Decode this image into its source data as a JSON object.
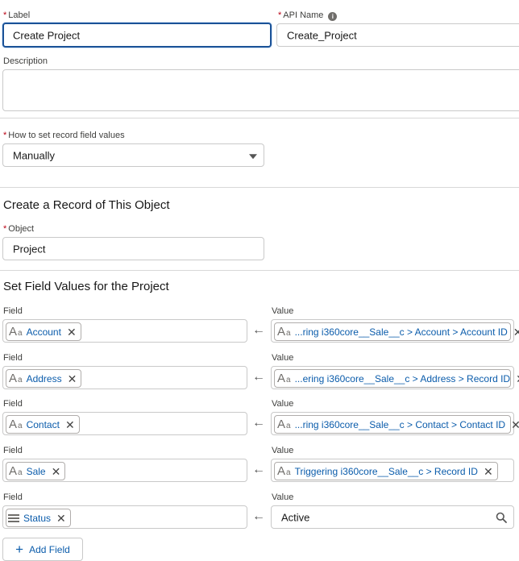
{
  "label": {
    "required": "*",
    "title": "Label",
    "value": "Create Project"
  },
  "api_name": {
    "required": "*",
    "title": "API Name",
    "value": "Create_Project",
    "info": "i"
  },
  "description": {
    "title": "Description",
    "value": ""
  },
  "how_to_set": {
    "required": "*",
    "title": "How to set record field values",
    "value": "Manually"
  },
  "section_record": {
    "heading": "Create a Record of This Object"
  },
  "object": {
    "required": "*",
    "title": "Object",
    "value": "Project"
  },
  "section_fields": {
    "heading": "Set Field Values for the Project"
  },
  "field_label": "Field",
  "value_label": "Value",
  "arrow": "←",
  "remove_glyph": "✕",
  "rows": [
    {
      "field": "Account",
      "field_icon": "text-type-icon",
      "value": "...ring i360core__Sale__c > Account > Account ID",
      "value_type": "pill"
    },
    {
      "field": "Address",
      "field_icon": "text-type-icon",
      "value": "...ering i360core__Sale__c > Address > Record ID",
      "value_type": "pill"
    },
    {
      "field": "Contact",
      "field_icon": "text-type-icon",
      "value": "...ring i360core__Sale__c > Contact > Contact ID",
      "value_type": "pill"
    },
    {
      "field": "Sale",
      "field_icon": "text-type-icon",
      "value": "Triggering i360core__Sale__c > Record ID",
      "value_type": "pill"
    },
    {
      "field": "Status",
      "field_icon": "picklist-icon",
      "value": "Active",
      "value_type": "text"
    }
  ],
  "add_field_button": {
    "plus": "+",
    "label": "Add Field"
  }
}
